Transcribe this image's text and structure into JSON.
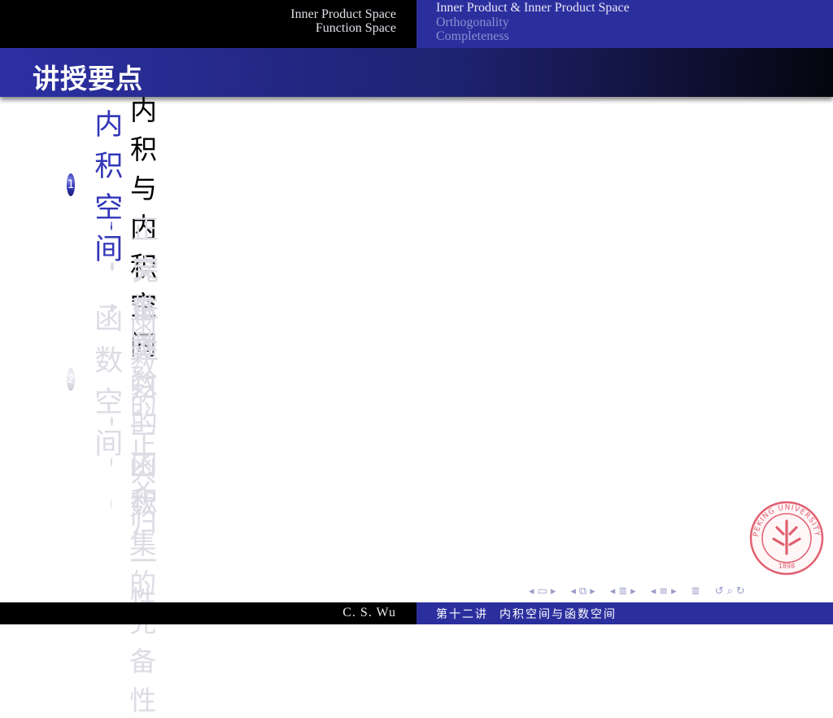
{
  "header": {
    "left_lines": [
      "Inner Product Space",
      "Function Space"
    ],
    "right_lines": [
      "Inner Product & Inner Product Space",
      "Orthogonality",
      "Completeness"
    ]
  },
  "frame": {
    "title": "讲授要点"
  },
  "outline": {
    "sections": [
      {
        "number": "1",
        "label": "内积空间",
        "state": "active",
        "items": [
          {
            "label": "内积与内积空间",
            "state": "active"
          },
          {
            "label": "正交性",
            "state": "faded"
          },
          {
            "label": "完备性",
            "state": "faded"
          }
        ]
      },
      {
        "number": "2",
        "label": "函数空间",
        "state": "faded",
        "items": [
          {
            "label": "函数的内积",
            "state": "faded"
          },
          {
            "label": "函数的正交归一性",
            "state": "faded"
          },
          {
            "label": "正交归一函数集的完备性",
            "state": "faded"
          }
        ]
      }
    ]
  },
  "logo": {
    "top_text": "PEKING UNIVERSITY",
    "year": "1898"
  },
  "footer": {
    "author": "C. S. Wu",
    "lecture": "第十二讲",
    "topic": "内积空间与函数空间"
  },
  "colors": {
    "accent": "#3236b8",
    "header_blue": "#2b2f9e",
    "faded_text": "#dcdce4",
    "seal_red": "#e06070"
  },
  "icons": [
    "nav-prev-frame-icon",
    "nav-next-frame-icon",
    "nav-prev-subsection-icon",
    "nav-next-subsection-icon",
    "nav-prev-section-icon",
    "nav-next-section-icon",
    "nav-appendix-icon",
    "nav-search-icon"
  ]
}
